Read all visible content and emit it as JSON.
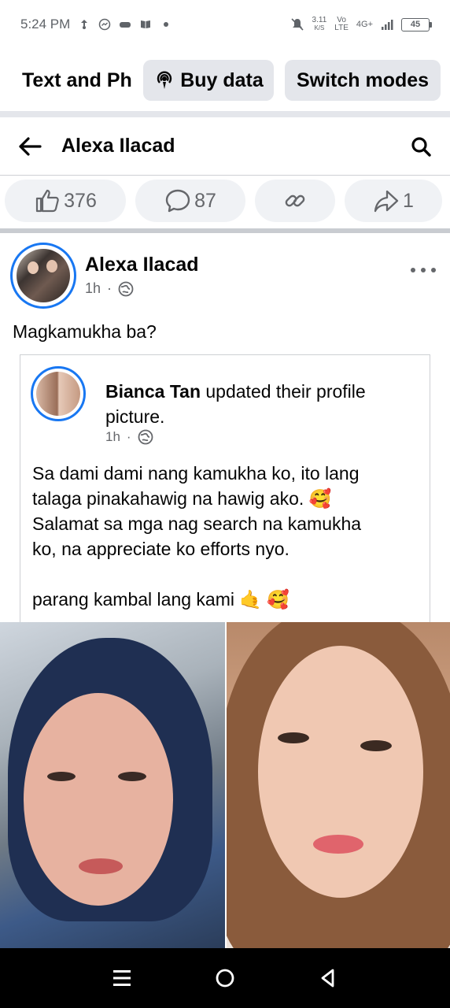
{
  "status_bar": {
    "time": "5:24 PM",
    "net_speed_value": "3.11",
    "net_speed_unit": "K/S",
    "vo_lte_top": "Vo",
    "vo_lte_bottom": "LTE",
    "signal_label": "4G+",
    "battery": "45"
  },
  "banner": {
    "text": "Text and Ph",
    "buy_data": "Buy data",
    "switch_modes": "Switch modes"
  },
  "header": {
    "title": "Alexa Ilacad"
  },
  "reactions": {
    "likes": "376",
    "comments": "87",
    "shares": "1"
  },
  "post": {
    "author": "Alexa Ilacad",
    "time": "1h",
    "separator": "·",
    "text": "Magkamukha ba?"
  },
  "shared": {
    "author": "Bianca Tan",
    "action": " updated their profile picture.",
    "time": "1h",
    "separator": "·",
    "line1": "Sa dami dami nang kamukha ko, ito lang",
    "line2": "talaga pinakahawig na hawig ako. 🥰",
    "line3": "Salamat sa mga nag search na kamukha",
    "line4": "ko, na appreciate ko efforts nyo.",
    "line5": "parang kambal lang kami 🤙 🥰"
  },
  "colors": {
    "accent_blue": "#1877f2",
    "text_primary": "#050505",
    "text_secondary": "#65676b",
    "pill_bg": "#e4e6eb"
  }
}
